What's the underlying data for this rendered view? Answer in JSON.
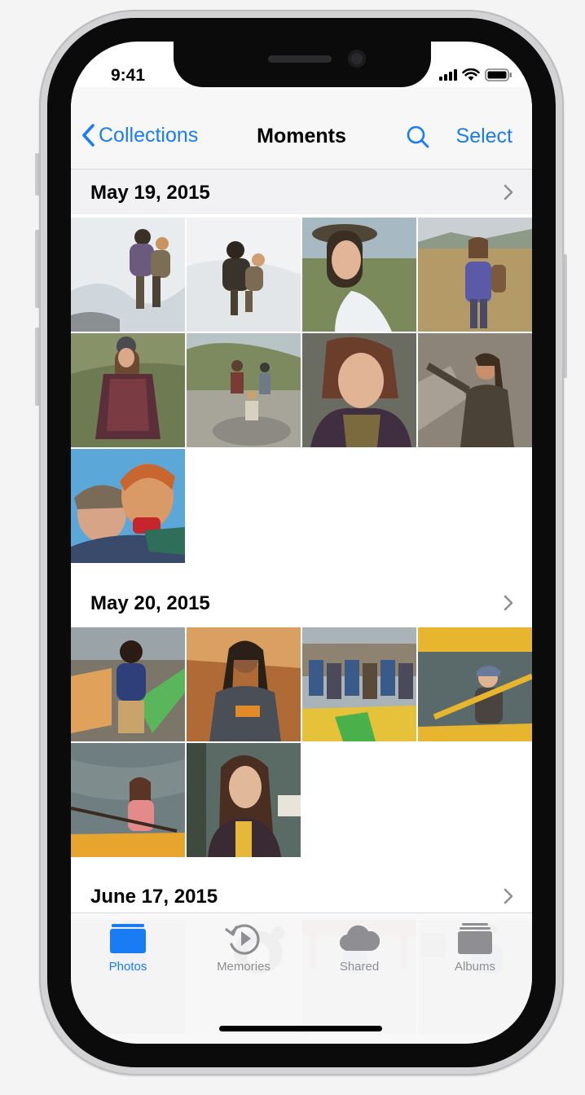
{
  "status_bar": {
    "time": "9:41",
    "icons": [
      "signal-icon",
      "wifi-icon",
      "battery-icon"
    ]
  },
  "nav": {
    "back_label": "Collections",
    "title": "Moments",
    "search_icon": "search-icon",
    "select_label": "Select"
  },
  "colors": {
    "accent": "#1a7cf5",
    "tab_inactive": "#8e8e93"
  },
  "sections": [
    {
      "date": "May 19, 2015",
      "photo_count": 9
    },
    {
      "date": "May 20, 2015",
      "photo_count": 6
    },
    {
      "date": "June 17, 2015",
      "photo_count": 4
    }
  ],
  "tabs": [
    {
      "label": "Photos",
      "icon": "photos-icon",
      "selected": true
    },
    {
      "label": "Memories",
      "icon": "memories-icon",
      "selected": false
    },
    {
      "label": "Shared",
      "icon": "shared-cloud-icon",
      "selected": false
    },
    {
      "label": "Albums",
      "icon": "albums-icon",
      "selected": false
    }
  ]
}
